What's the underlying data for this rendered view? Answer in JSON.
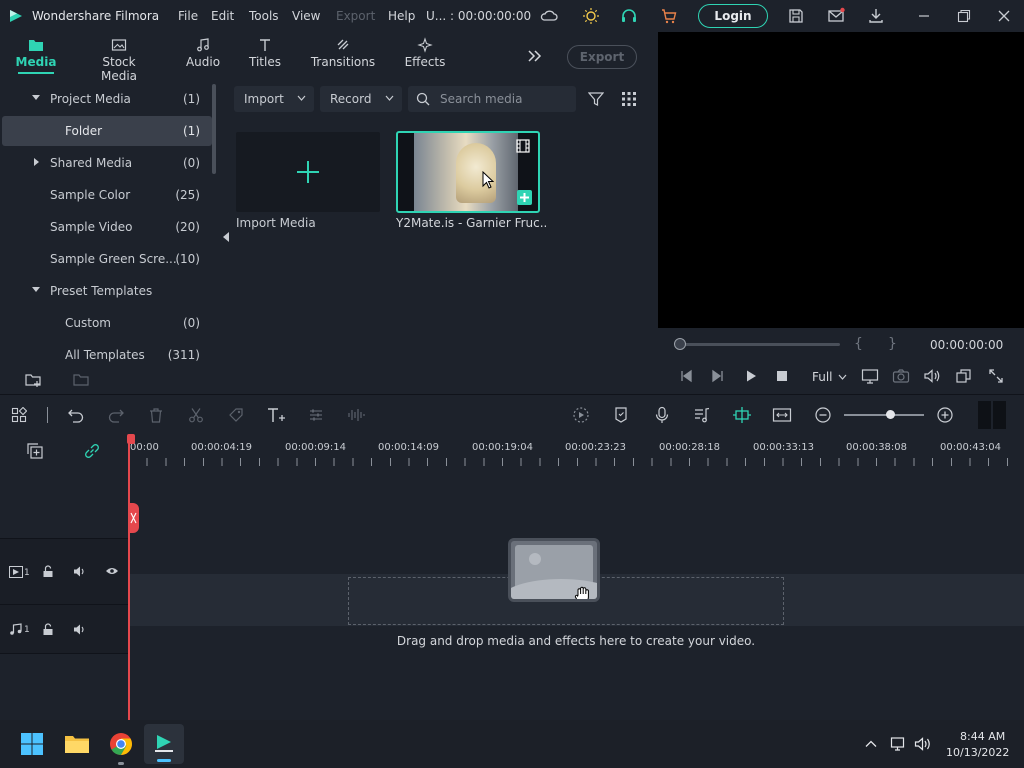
{
  "app": {
    "title": "Wondershare Filmora",
    "accent": "#2fd4b4"
  },
  "menu": {
    "file": "File",
    "edit": "Edit",
    "tools": "Tools",
    "view": "View",
    "export": "Export",
    "help": "Help",
    "project_status": "U... : 00:00:00:00"
  },
  "titlebar": {
    "login_label": "Login"
  },
  "tabs": [
    {
      "label": "Media",
      "icon": "folder-icon",
      "active": true
    },
    {
      "label": "Stock Media",
      "icon": "image-icon"
    },
    {
      "label": "Audio",
      "icon": "music-icon"
    },
    {
      "label": "Titles",
      "icon": "text-icon"
    },
    {
      "label": "Transitions",
      "icon": "transition-icon"
    },
    {
      "label": "Effects",
      "icon": "sparkle-icon"
    }
  ],
  "export_label": "Export",
  "sidebar": {
    "items": [
      {
        "label": "Project Media",
        "count": "(1)",
        "expanded": true
      },
      {
        "label": "Folder",
        "count": "(1)",
        "active": true
      },
      {
        "label": "Shared Media",
        "count": "(0)",
        "expanded": false
      },
      {
        "label": "Sample Color",
        "count": "(25)"
      },
      {
        "label": "Sample Video",
        "count": "(20)"
      },
      {
        "label": "Sample Green Scre...",
        "count": "(10)"
      },
      {
        "label": "Preset Templates",
        "count": "",
        "expanded": true
      },
      {
        "label": "Custom",
        "count": "(0)"
      },
      {
        "label": "All Templates",
        "count": "(311)"
      }
    ]
  },
  "media_toolbar": {
    "import_label": "Import",
    "record_label": "Record",
    "search_placeholder": "Search media"
  },
  "media_items": [
    {
      "label": "Import Media"
    },
    {
      "label": "Y2Mate.is - Garnier Fruc..."
    }
  ],
  "preview": {
    "timecode": "00:00:00:00",
    "quality": "Full",
    "bracket_in": "{",
    "bracket_out": "}"
  },
  "ruler": {
    "ticks": [
      "00:00",
      "00:00:04:19",
      "00:00:09:14",
      "00:00:14:09",
      "00:00:19:04",
      "00:00:23:23",
      "00:00:28:18",
      "00:00:33:13",
      "00:00:38:08",
      "00:00:43:04"
    ]
  },
  "tracks": {
    "video_label": "1",
    "audio_label": "1",
    "drop_hint": "Drag and drop media and effects here to create your video."
  },
  "taskbar": {
    "time": "8:44 AM",
    "date": "10/13/2022"
  }
}
